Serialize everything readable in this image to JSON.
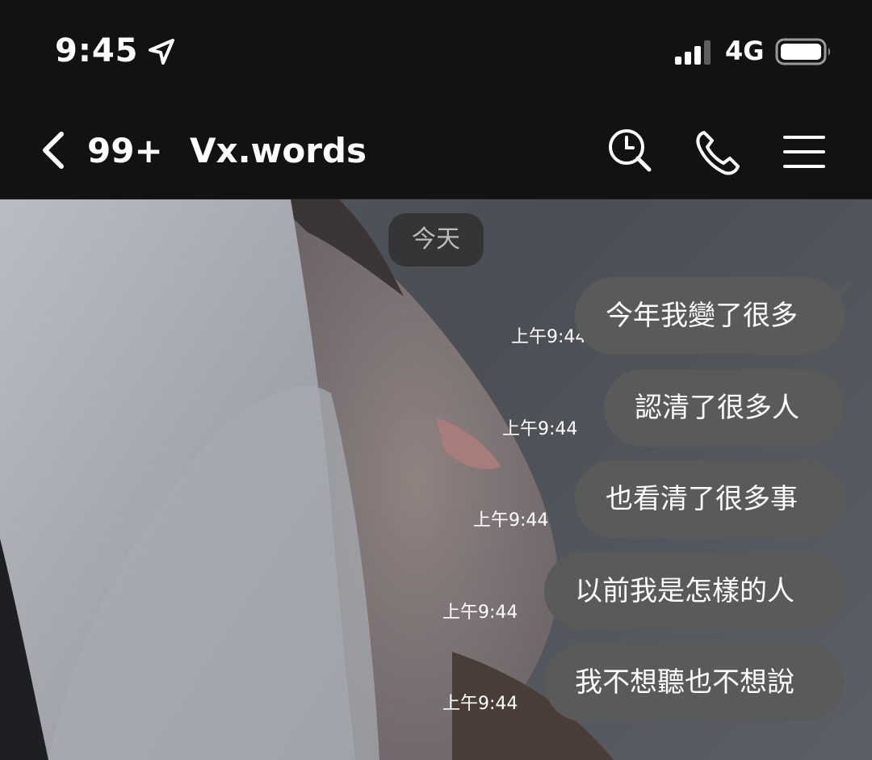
{
  "status_bar": {
    "time": "9:45",
    "network": "4G",
    "icons": [
      "location-arrow-icon",
      "signal-bars-icon",
      "battery-icon"
    ]
  },
  "header": {
    "unread_count": "99+",
    "title": "Vx.words",
    "icons": [
      "back-chevron-icon",
      "search-icon",
      "phone-icon",
      "menu-icon"
    ]
  },
  "chat": {
    "date_separator": "今天",
    "messages": [
      {
        "text": "今年我變了很多",
        "time": "上午9:44"
      },
      {
        "text": "認清了很多人",
        "time": "上午9:44"
      },
      {
        "text": "也看清了很多事",
        "time": "上午9:44"
      },
      {
        "text": "以前我是怎樣的人",
        "time": "上午9:44"
      },
      {
        "text": "我不想聽也不想說",
        "time": "上午9:44"
      }
    ]
  },
  "colors": {
    "bar_background": "#121212",
    "bubble": "#5a5a5a",
    "text": "#ffffff",
    "date_pill": "#303030"
  }
}
